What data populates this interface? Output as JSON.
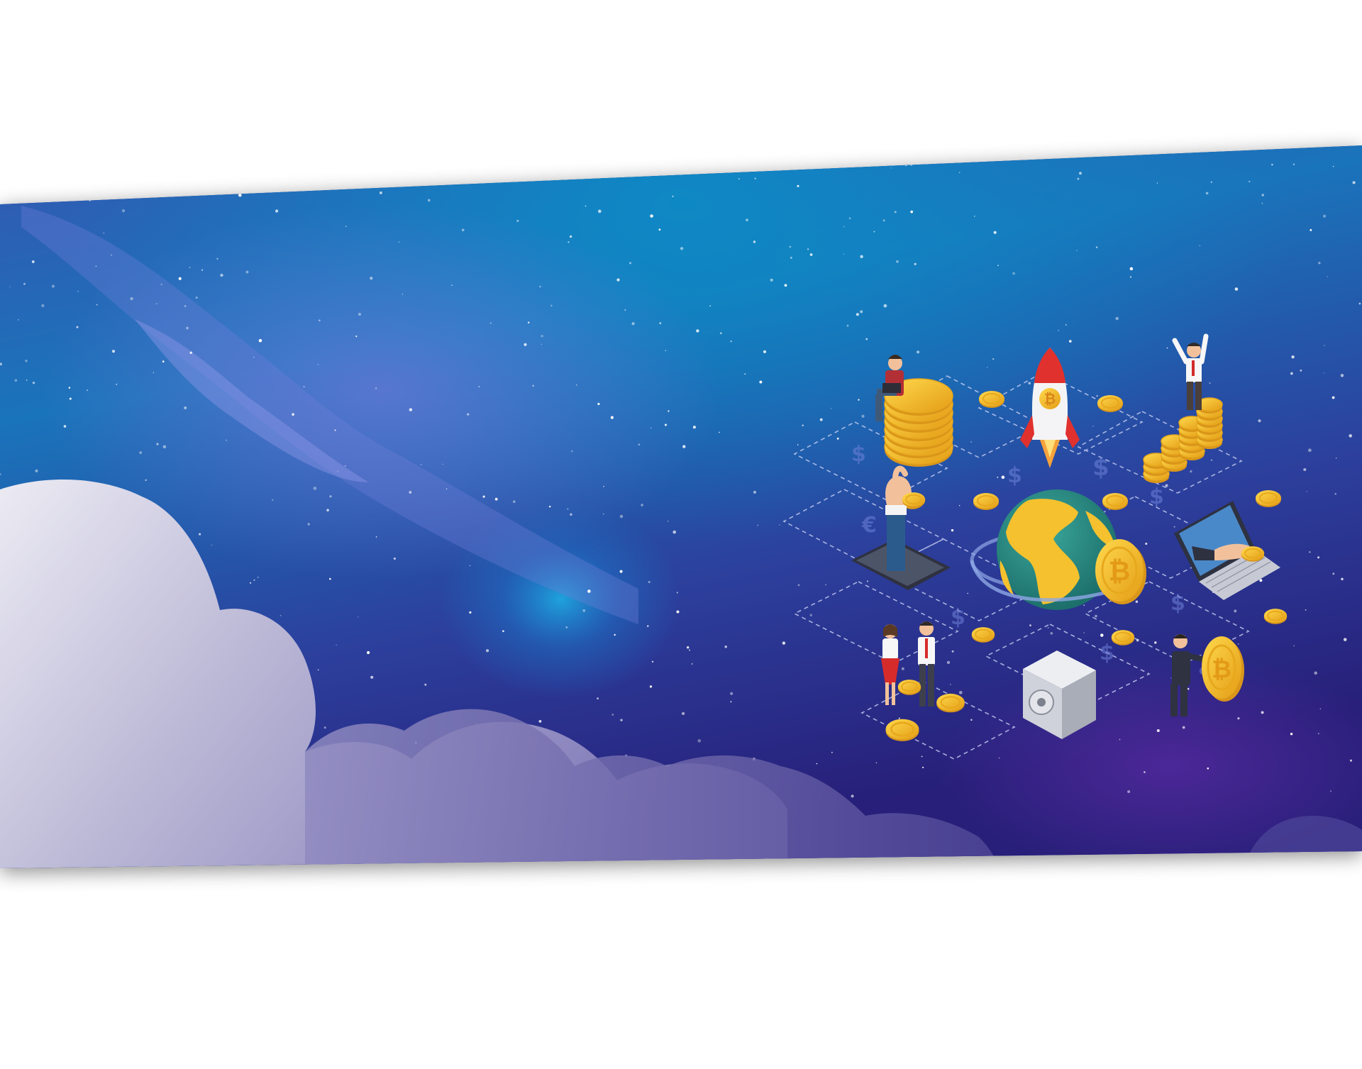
{
  "banner": {
    "colors": {
      "page_background": "#ffffff",
      "sky_top": "#0b86c2",
      "sky_mid": "#2b4fa6",
      "sky_bottom": "#2a2580",
      "cloud_light": "#e6e5ef",
      "cloud_mid": "#a7a4c9",
      "cloud_deep": "#6a64a8",
      "coin_gold": "#f5c12e",
      "coin_edge": "#d9961a",
      "globe_ocean": "#2e8f86",
      "rocket_red": "#e0312e"
    },
    "coin_symbol": "₿",
    "infographic_items": [
      {
        "id": "coin-stack-man",
        "icon": "person-on-coin-stack-icon"
      },
      {
        "id": "rocket",
        "icon": "rocket-icon"
      },
      {
        "id": "celebrating-man",
        "icon": "person-on-coin-bars-icon"
      },
      {
        "id": "tablet-hand",
        "icon": "hand-from-tablet-icon"
      },
      {
        "id": "globe",
        "icon": "globe-with-coin-icon"
      },
      {
        "id": "laptop-hand",
        "icon": "hand-from-laptop-icon"
      },
      {
        "id": "handshake",
        "icon": "business-people-icon"
      },
      {
        "id": "safe",
        "icon": "safe-icon"
      },
      {
        "id": "coin-pusher",
        "icon": "man-pushing-coin-icon"
      }
    ]
  }
}
